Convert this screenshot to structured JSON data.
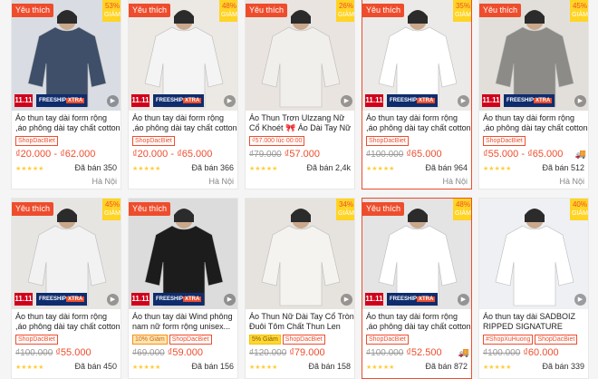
{
  "products": [
    {
      "fav": "Yêu thích",
      "discount": "53%",
      "discount_word": "GIẢM",
      "banner_a": "11.11",
      "banner_b": "FREESHIP",
      "banner_c": "XTRA",
      "title": "Áo thun tay dài form rộng ,áo phông dài tay chất cotton d...",
      "badges": [
        "ShopDacBiet"
      ],
      "old_price": "",
      "price": "₫20.000 - ₫62.000",
      "stars": "★★★★★",
      "sold": "Đã bán 350",
      "location": "Hà Nội",
      "bg": "#d9dde3",
      "shirt": "#3f4f6a"
    },
    {
      "fav": "Yêu thích",
      "discount": "48%",
      "discount_word": "GIẢM",
      "banner_a": "11.11",
      "banner_b": "FREESHIP",
      "banner_c": "XTRA",
      "title": "Áo thun tay dài form rộng ,áo phông dài tay chất cotton d...",
      "badges": [
        "ShopDacBiet"
      ],
      "old_price": "",
      "price": "₫20.000 - ₫65.000",
      "stars": "★★★★★",
      "sold": "Đã bán 366",
      "location": "Hà Nội",
      "bg": "#ece8e4",
      "shirt": "#f4f4f4"
    },
    {
      "fav": "Yêu thích",
      "discount": "26%",
      "discount_word": "GIẢM",
      "banner_a": "",
      "banner_b": "",
      "banner_c": "",
      "title": "Áo Thun Trơn Ulzzang Nữ Cổ Khoét 🎀 Áo Dài Tay Nữ Ch...",
      "badges": [
        "₫57.000 lúc 00:00"
      ],
      "old_price": "₫79.000",
      "price": "₫57.000",
      "stars": "★★★★★",
      "sold": "Đã bán 2,4k",
      "location": "",
      "bg": "#e9e4df",
      "shirt": "#f1efec"
    },
    {
      "fav": "Yêu thích",
      "discount": "35%",
      "discount_word": "GIẢM",
      "banner_a": "11.11",
      "banner_b": "FREESHIP",
      "banner_c": "XTRA",
      "title": "Áo thun tay dài form rộng ,áo phông dài tay chất cotton d...",
      "badges": [
        "ShopDacBiet"
      ],
      "old_price": "₫100.000",
      "price": "₫65.000",
      "stars": "★★★★★",
      "sold": "Đã bán 964",
      "location": "Hà Nội",
      "bg": "#eceae8",
      "shirt": "#ffffff"
    },
    {
      "fav": "Yêu thích",
      "discount": "45%",
      "discount_word": "GIẢM",
      "banner_a": "11.11",
      "banner_b": "FREESHIP",
      "banner_c": "XTRA",
      "title": "Áo thun tay dài form rộng ,áo phông dài tay chất cotton d...",
      "badges": [
        "ShopDacBiet"
      ],
      "old_price": "",
      "price": "₫55.000 - ₫65.000",
      "stars": "★★★★★",
      "sold": "Đã bán 512",
      "location": "Hà Nội",
      "bg": "#e2dfdb",
      "shirt": "#8c8b87"
    },
    {
      "fav": "Yêu thích",
      "discount": "45%",
      "discount_word": "GIẢM",
      "banner_a": "11.11",
      "banner_b": "FREESHIP",
      "banner_c": "XTRA",
      "title": "Áo thun tay dài form rộng ,áo phông dài tay chất cotton d...",
      "badges": [
        "ShopDacBiet"
      ],
      "old_price": "₫100.000",
      "price": "₫55.000",
      "stars": "★★★★★",
      "sold": "Đã bán 450",
      "location": "",
      "bg": "#e7e5e2",
      "shirt": "#f2f2f2"
    },
    {
      "fav": "Yêu thích",
      "discount": "",
      "discount_word": "",
      "banner_a": "11.11",
      "banner_b": "FREESHIP",
      "banner_c": "XTRA",
      "title": "Áo thun tay dài Wind phông nam nữ form rộng unisex...",
      "badges": [
        "10% Giảm",
        "ShopDacBiet"
      ],
      "old_price": "₫69.000",
      "price": "₫59.000",
      "stars": "★★★★★",
      "sold": "Đã bán 156",
      "location": "",
      "bg": "#dcdcdc",
      "shirt": "#1c1c1c"
    },
    {
      "fav": "",
      "discount": "34%",
      "discount_word": "GIẢM",
      "banner_a": "",
      "banner_b": "",
      "banner_c": "",
      "title": "Áo Thun Nữ Dài Tay Cổ Tròn Đuôi Tôm Chất Thun Len Tă...",
      "badges": [
        "5% Giảm",
        "ShopDacBiet"
      ],
      "old_price": "₫120.000",
      "price": "₫79.000",
      "stars": "★★★★★",
      "sold": "Đã bán 158",
      "location": "",
      "bg": "#e6e2dd",
      "shirt": "#f5f3ef"
    },
    {
      "fav": "Yêu thích",
      "discount": "48%",
      "discount_word": "GIẢM",
      "banner_a": "11.11",
      "banner_b": "FREESHIP",
      "banner_c": "XTRA",
      "title": "Áo thun tay dài form rộng ,áo phông dài tay chất cotton d...",
      "badges": [
        "ShopDacBiet"
      ],
      "old_price": "₫100.000",
      "price": "₫52.500",
      "stars": "★★★★★",
      "sold": "Đã bán 872",
      "location": "",
      "bg": "#e4e4e4",
      "shirt": "#ffffff"
    },
    {
      "fav": "",
      "discount": "40%",
      "discount_word": "GIẢM",
      "banner_a": "",
      "banner_b": "",
      "banner_c": "",
      "title": "Áo thun tay dài SADBOIZ RIPPED SIGNATURE LONG...",
      "badges": [
        "#ShopXuHuong",
        "ShopDacBiet"
      ],
      "old_price": "₫100.000",
      "price": "₫60.000",
      "stars": "★★★★★",
      "sold": "Đã bán 339",
      "location": "",
      "bg": "#eef0f4",
      "shirt": "#ffffff"
    }
  ],
  "colors": {
    "accent": "#ee4d2d",
    "star": "#ffce3d",
    "freeship": "#0f2c6d"
  },
  "icons": {
    "play": "play-icon",
    "truck": "free-shipping-truck-icon"
  }
}
